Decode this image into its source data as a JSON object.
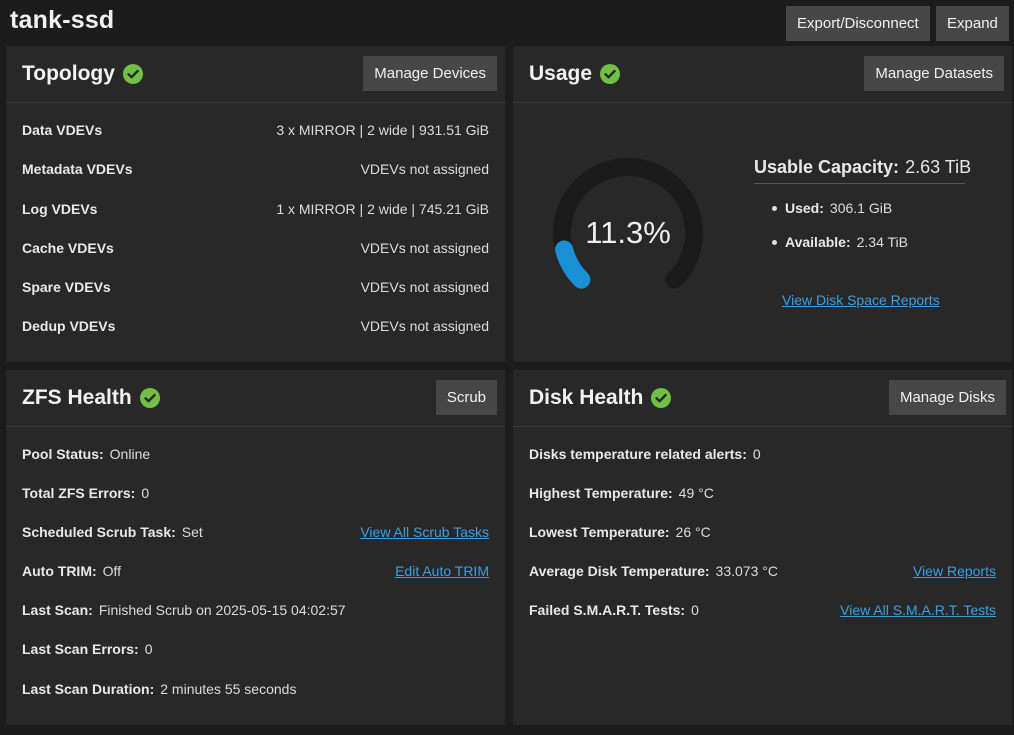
{
  "pool": {
    "name": "tank-ssd",
    "export_label": "Export/Disconnect",
    "expand_label": "Expand"
  },
  "topology": {
    "title": "Topology",
    "manage_label": "Manage Devices",
    "rows": [
      {
        "label": "Data VDEVs",
        "value": "3 x MIRROR | 2 wide | 931.51 GiB"
      },
      {
        "label": "Metadata VDEVs",
        "value": "VDEVs not assigned"
      },
      {
        "label": "Log VDEVs",
        "value": "1 x MIRROR | 2 wide | 745.21 GiB"
      },
      {
        "label": "Cache VDEVs",
        "value": "VDEVs not assigned"
      },
      {
        "label": "Spare VDEVs",
        "value": "VDEVs not assigned"
      },
      {
        "label": "Dedup VDEVs",
        "value": "VDEVs not assigned"
      }
    ]
  },
  "usage": {
    "title": "Usage",
    "manage_label": "Manage Datasets",
    "percent_text": "11.3%",
    "percent_value": 11.3,
    "capacity_label": "Usable Capacity:",
    "capacity_value": "2.63 TiB",
    "used_label": "Used:",
    "used_value": "306.1 GiB",
    "available_label": "Available:",
    "available_value": "2.34 TiB",
    "report_link": "View Disk Space Reports",
    "gauge_color": "#1a8fd6",
    "track_color": "#1b1b1b"
  },
  "zfs": {
    "title": "ZFS Health",
    "scrub_label": "Scrub",
    "rows": [
      {
        "label": "Pool Status:",
        "value": "Online",
        "link": ""
      },
      {
        "label": "Total ZFS Errors:",
        "value": "0",
        "link": ""
      },
      {
        "label": "Scheduled Scrub Task:",
        "value": "Set",
        "link": "View All Scrub Tasks"
      },
      {
        "label": "Auto TRIM:",
        "value": "Off",
        "link": "Edit Auto TRIM"
      },
      {
        "label": "Last Scan:",
        "value": "Finished Scrub on 2025-05-15 04:02:57",
        "link": ""
      },
      {
        "label": "Last Scan Errors:",
        "value": "0",
        "link": ""
      },
      {
        "label": "Last Scan Duration:",
        "value": "2 minutes 55 seconds",
        "link": ""
      }
    ]
  },
  "disk": {
    "title": "Disk Health",
    "manage_label": "Manage Disks",
    "rows": [
      {
        "label": "Disks temperature related alerts:",
        "value": "0",
        "link": ""
      },
      {
        "label": "Highest Temperature:",
        "value": "49 °C",
        "link": ""
      },
      {
        "label": "Lowest Temperature:",
        "value": "26 °C",
        "link": ""
      },
      {
        "label": "Average Disk Temperature:",
        "value": "33.073 °C",
        "link": "View Reports"
      },
      {
        "label": "Failed S.M.A.R.T. Tests:",
        "value": "0",
        "link": "View All S.M.A.R.T. Tests"
      }
    ]
  },
  "colors": {
    "status_ok": "#71bf44",
    "link": "#3aa0e6"
  }
}
